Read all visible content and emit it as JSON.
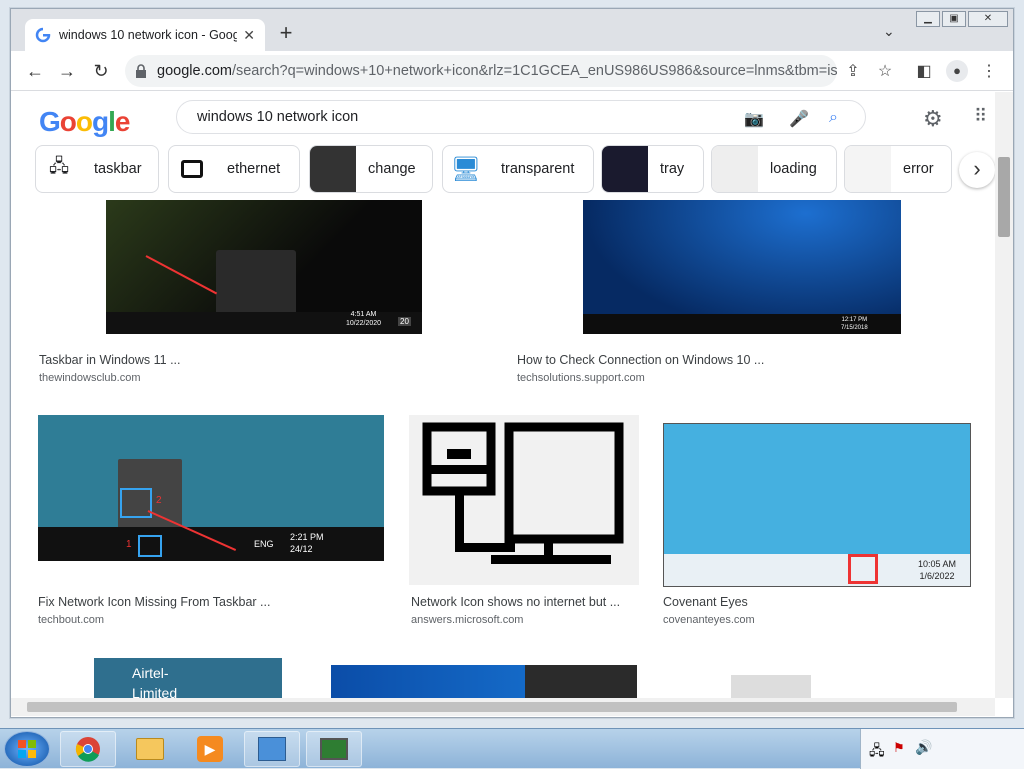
{
  "browser": {
    "tab_title": "windows 10 network icon - Goog",
    "new_tab": "+",
    "url_domain": "google.com",
    "url_rest": "/search?q=windows+10+network+icon&rlz=1C1GCEA_enUS986US986&source=lnms&tbm=isc..."
  },
  "google": {
    "logo": [
      "G",
      "o",
      "o",
      "g",
      "l",
      "e"
    ],
    "query": "windows 10 network icon"
  },
  "chips": [
    "taskbar",
    "ethernet",
    "change",
    "transparent",
    "tray",
    "loading",
    "error"
  ],
  "results": [
    {
      "title": "Taskbar in Windows 11 ...",
      "source": "thewindowsclub.com",
      "time": "4:51 AM",
      "date": "10/22/2020",
      "badge": "20"
    },
    {
      "title": "How to Check Connection on Windows 10 ...",
      "source": "techsolutions.support.com",
      "time": "12:17 PM",
      "date": "7/15/2018"
    },
    {
      "title": "Fix Network Icon Missing From Taskbar ...",
      "source": "techbout.com",
      "time": "2:21 PM",
      "date": "24/12",
      "lang": "ENG",
      "n1": "1",
      "n2": "2"
    },
    {
      "title": "Network Icon shows no internet but ...",
      "source": "answers.microsoft.com"
    },
    {
      "title": "Covenant Eyes",
      "source": "covenanteyes.com",
      "time": "10:05 AM",
      "date": "1/6/2022"
    },
    {
      "title": "",
      "source": "",
      "wifi_a": "Airtel-",
      "wifi_b": "Limited"
    }
  ],
  "colors": {
    "accent": "#1a73e8",
    "taskbar": "#8db3d8"
  }
}
